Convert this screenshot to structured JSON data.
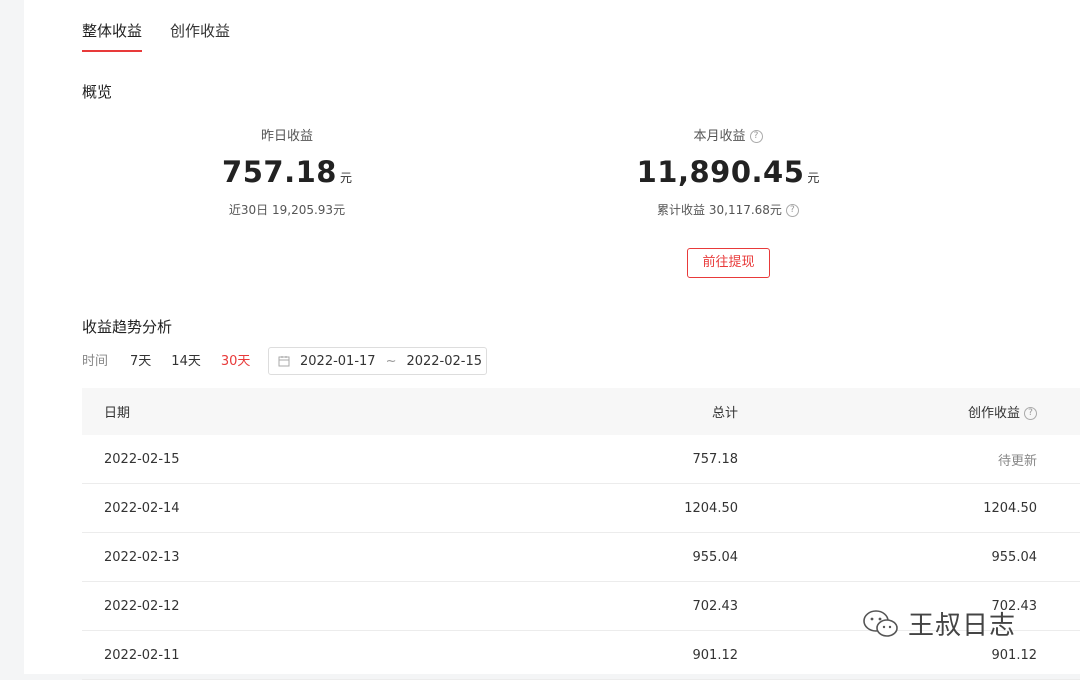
{
  "tabs": [
    {
      "label": "整体收益",
      "active": true
    },
    {
      "label": "创作收益",
      "active": false
    }
  ],
  "overview": {
    "title": "概览",
    "yesterday": {
      "label": "昨日收益",
      "value": "757.18",
      "unit": "元",
      "sub": "近30日 19,205.93元"
    },
    "month": {
      "label": "本月收益",
      "value": "11,890.45",
      "unit": "元",
      "sub": "累计收益 30,117.68元"
    },
    "withdraw_label": "前往提现"
  },
  "trend": {
    "title": "收益趋势分析",
    "time_label": "时间",
    "options": [
      "7天",
      "14天",
      "30天"
    ],
    "active_option": "30天",
    "range_start": "2022-01-17",
    "range_sep": "~",
    "range_end": "2022-02-15"
  },
  "table": {
    "headers": {
      "date": "日期",
      "total": "总计",
      "create": "创作收益"
    },
    "rows": [
      {
        "date": "2022-02-15",
        "total": "757.18",
        "create": "待更新"
      },
      {
        "date": "2022-02-14",
        "total": "1204.50",
        "create": "1204.50"
      },
      {
        "date": "2022-02-13",
        "total": "955.04",
        "create": "955.04"
      },
      {
        "date": "2022-02-12",
        "total": "702.43",
        "create": "702.43"
      },
      {
        "date": "2022-02-11",
        "total": "901.12",
        "create": "901.12"
      }
    ]
  },
  "watermark": {
    "text": "王叔日志",
    "icon": "wechat-icon"
  },
  "colors": {
    "accent": "#e83a3a"
  }
}
